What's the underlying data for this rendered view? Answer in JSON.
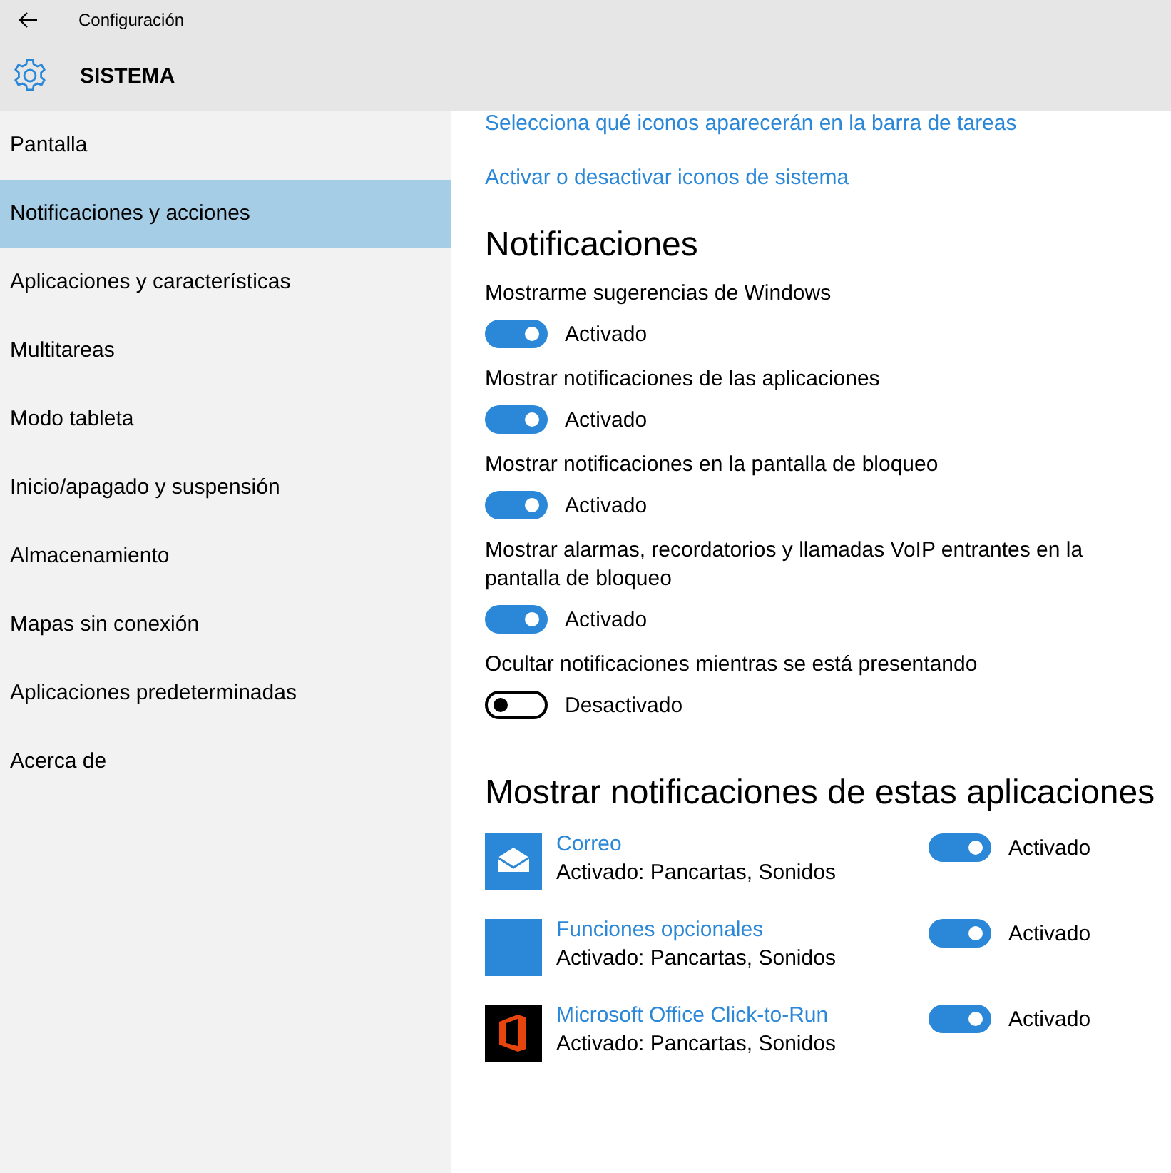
{
  "window": {
    "title": "Configuración"
  },
  "header": {
    "title": "SISTEMA"
  },
  "sidebar": {
    "items": [
      {
        "label": "Pantalla",
        "selected": false
      },
      {
        "label": "Notificaciones y acciones",
        "selected": true
      },
      {
        "label": "Aplicaciones y características",
        "selected": false
      },
      {
        "label": "Multitareas",
        "selected": false
      },
      {
        "label": "Modo tableta",
        "selected": false
      },
      {
        "label": "Inicio/apagado y suspensión",
        "selected": false
      },
      {
        "label": "Almacenamiento",
        "selected": false
      },
      {
        "label": "Mapas sin conexión",
        "selected": false
      },
      {
        "label": "Aplicaciones predeterminadas",
        "selected": false
      },
      {
        "label": "Acerca de",
        "selected": false
      }
    ]
  },
  "links": [
    "Selecciona qué iconos aparecerán en la barra de tareas",
    "Activar o desactivar iconos de sistema"
  ],
  "notifications": {
    "title": "Notificaciones",
    "settings": [
      {
        "label": "Mostrarme sugerencias de Windows",
        "on": true,
        "state": "Activado"
      },
      {
        "label": "Mostrar notificaciones de las aplicaciones",
        "on": true,
        "state": "Activado"
      },
      {
        "label": "Mostrar notificaciones en la pantalla de bloqueo",
        "on": true,
        "state": "Activado"
      },
      {
        "label": "Mostrar alarmas, recordatorios y llamadas VoIP entrantes en la pantalla de bloqueo",
        "on": true,
        "state": "Activado"
      },
      {
        "label": "Ocultar notificaciones mientras se está presentando",
        "on": false,
        "state": "Desactivado"
      }
    ]
  },
  "apps": {
    "title": "Mostrar notificaciones de estas aplicaciones",
    "items": [
      {
        "kind": "mail",
        "name": "Correo",
        "detail": "Activado: Pancartas, Sonidos",
        "on": true,
        "state": "Activado"
      },
      {
        "kind": "blank",
        "name": "Funciones opcionales",
        "detail": "Activado: Pancartas, Sonidos",
        "on": true,
        "state": "Activado"
      },
      {
        "kind": "office",
        "name": "Microsoft Office Click-to-Run",
        "detail": "Activado: Pancartas, Sonidos",
        "on": true,
        "state": "Activado"
      }
    ]
  }
}
